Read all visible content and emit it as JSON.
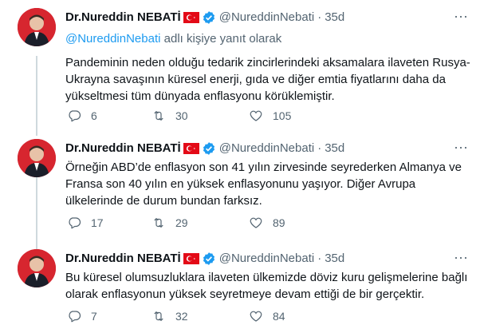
{
  "tweets": [
    {
      "name": "Dr.Nureddin NEBATİ",
      "handle": "@NureddinNebati",
      "time": "35d",
      "reply_mention": "@NureddinNebati",
      "reply_suffix": " adlı kişiye yanıt olarak",
      "lines": [
        "Pandeminin neden olduğu tedarik zincirlerindeki aksamalara ilaveten Rusya-",
        "Ukrayna savaşının küresel enerji, gıda ve diğer emtia fiyatlarını daha da",
        "yükseltmesi tüm dünyada enflasyonu körüklemiştir."
      ],
      "replies": "6",
      "retweets": "30",
      "likes": "105"
    },
    {
      "name": "Dr.Nureddin NEBATİ",
      "handle": "@NureddinNebati",
      "time": "35d",
      "lines": [
        "Örneğin ABD’de enflasyon son 41 yılın zirvesinde seyrederken Almanya ve",
        "Fransa son 40 yılın en yüksek enflasyonunu yaşıyor. Diğer Avrupa",
        "ülkelerinde de durum bundan farksız."
      ],
      "replies": "17",
      "retweets": "29",
      "likes": "89"
    },
    {
      "name": "Dr.Nureddin NEBATİ",
      "handle": "@NureddinNebati",
      "time": "35d",
      "lines": [
        "Bu küresel olumsuzluklara ilaveten ülkemizde döviz kuru gelişmelerine bağlı",
        "olarak enflasyonun yüksek seyretmeye devam ettiği de bir gerçektir."
      ],
      "replies": "7",
      "retweets": "32",
      "likes": "84"
    }
  ],
  "icons": {
    "flag": "turkey-flag-icon",
    "verified": "verified-badge-icon",
    "more": "more-icon",
    "reply": "reply-icon",
    "retweet": "retweet-icon",
    "like": "heart-icon"
  },
  "colors": {
    "link": "#1d9bf0",
    "muted": "#536471",
    "text": "#0f1419",
    "flag_red": "#e30a17"
  }
}
